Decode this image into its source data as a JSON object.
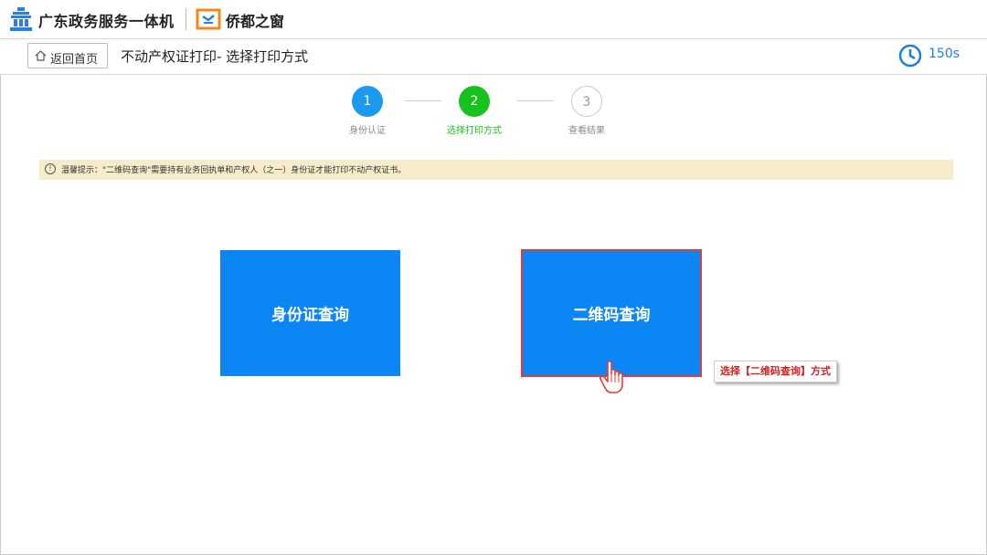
{
  "header": {
    "app_title": "广东政务服务一体机",
    "sub_title": "侨都之窗"
  },
  "nav": {
    "home_label": "返回首页",
    "page_title": "不动产权证打印- 选择打印方式",
    "timer": "150s"
  },
  "steps": [
    {
      "number": "1",
      "label": "身份认证",
      "state": "done",
      "color": "#1a9af0"
    },
    {
      "number": "2",
      "label": "选择打印方式",
      "state": "active",
      "color": "#17c21c"
    },
    {
      "number": "3",
      "label": "查看结果",
      "state": "pending",
      "color": "#9a9a9a"
    }
  ],
  "notice": {
    "text": "温馨提示：\"二维码查询\"需要持有业务回执单和产权人（之一）身份证才能打印不动产权证书。",
    "icon": "info-circle-icon"
  },
  "options": {
    "id_card": "身份证查询",
    "qr_code": "二维码查询"
  },
  "annotation": {
    "callout": "选择【二维码查询】方式"
  },
  "colors": {
    "primary": "#0c86f4",
    "accent_red": "#e23b3b",
    "notice_bg": "#f7ecca"
  }
}
